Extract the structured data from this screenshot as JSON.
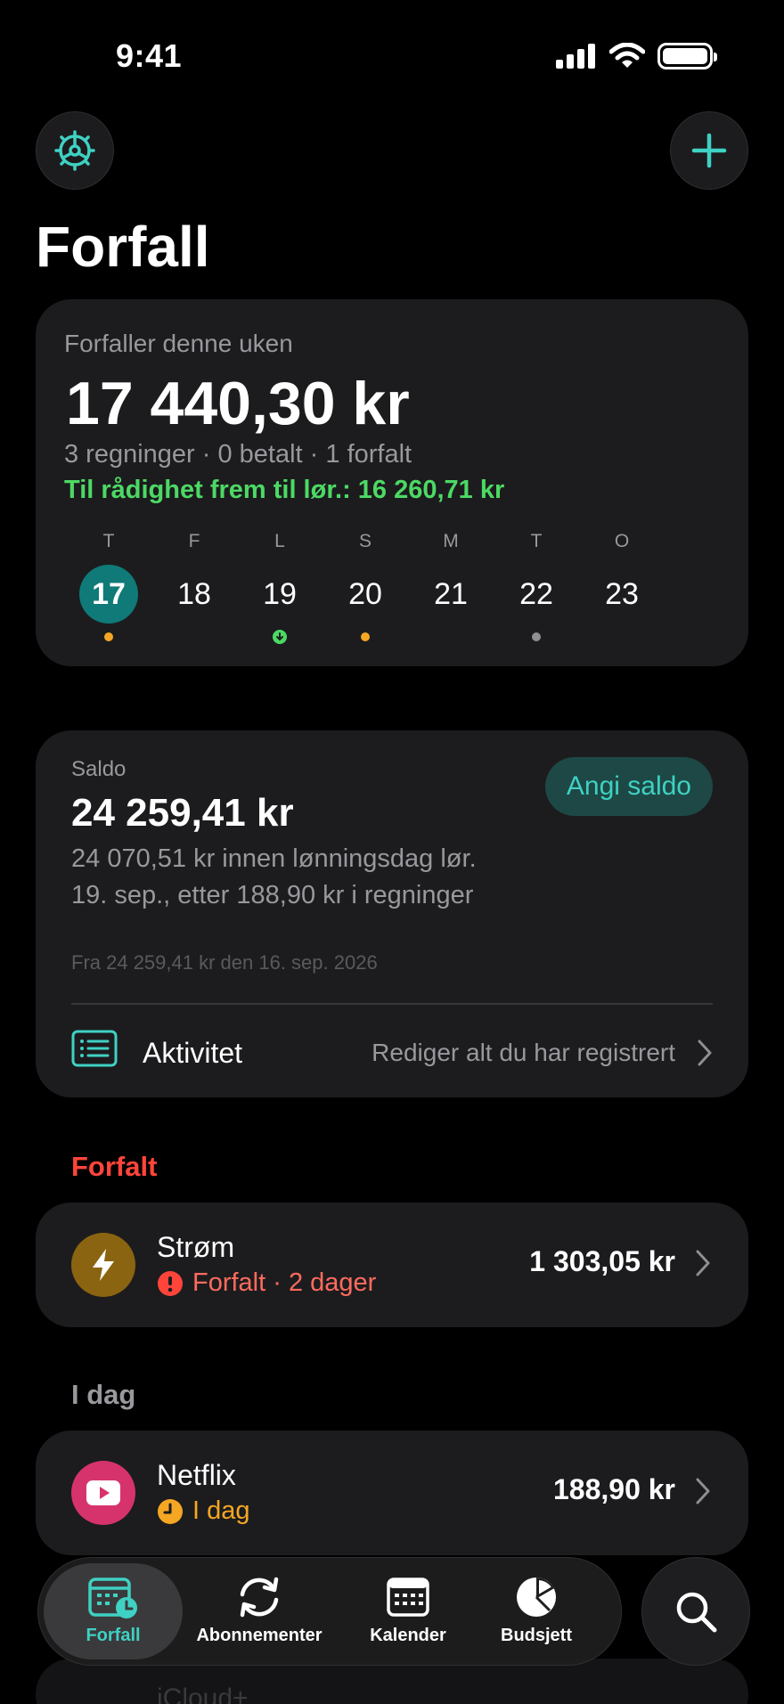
{
  "status_bar": {
    "time": "9:41"
  },
  "header": {
    "title": "Forfall"
  },
  "colors": {
    "accent": "#3fd1c3",
    "overdue": "#ff453a",
    "ok": "#4cd964",
    "warning": "#f5a623"
  },
  "week": {
    "label": "Forfaller denne uken",
    "amount": "17 440,30 kr",
    "summary": "3 regninger · 0 betalt · 1 forfalt",
    "available": "Til rådighet frem til lør.: 16 260,71 kr",
    "days": [
      {
        "letter": "T",
        "num": "17",
        "selected": true,
        "marker": "orange-dot"
      },
      {
        "letter": "F",
        "num": "18",
        "marker": "none"
      },
      {
        "letter": "L",
        "num": "19",
        "marker": "green-arrow-down"
      },
      {
        "letter": "S",
        "num": "20",
        "marker": "orange-dot"
      },
      {
        "letter": "M",
        "num": "21",
        "marker": "none"
      },
      {
        "letter": "T",
        "num": "22",
        "marker": "gray-dot"
      },
      {
        "letter": "O",
        "num": "23",
        "marker": "none"
      }
    ]
  },
  "saldo": {
    "label": "Saldo",
    "amount": "24 259,41 kr",
    "description": "24 070,51 kr innen lønningsdag lør. 19. sep., etter 188,90 kr i regninger",
    "from": "Fra 24 259,41 kr den 16. sep. 2026",
    "set_button": "Angi saldo",
    "activity_label": "Aktivitet",
    "activity_hint": "Rediger alt du har registrert"
  },
  "sections": {
    "overdue": "Forfalt",
    "today": "I dag"
  },
  "bills": {
    "strom": {
      "name": "Strøm",
      "status": "Forfalt · 2 dager",
      "amount": "1 303,05 kr",
      "icon": "lightning-icon",
      "icon_color": "#8a6410"
    },
    "netflix": {
      "name": "Netflix",
      "status": "I dag",
      "amount": "188,90 kr",
      "icon": "play-icon",
      "icon_color": "#d6336c"
    }
  },
  "peek": {
    "text": "iCloud+"
  },
  "tabs": [
    {
      "label": "Forfall",
      "icon": "calendar-clock-icon"
    },
    {
      "label": "Abonnementer",
      "icon": "refresh-icon"
    },
    {
      "label": "Kalender",
      "icon": "calendar-icon"
    },
    {
      "label": "Budsjett",
      "icon": "pie-chart-icon"
    }
  ]
}
